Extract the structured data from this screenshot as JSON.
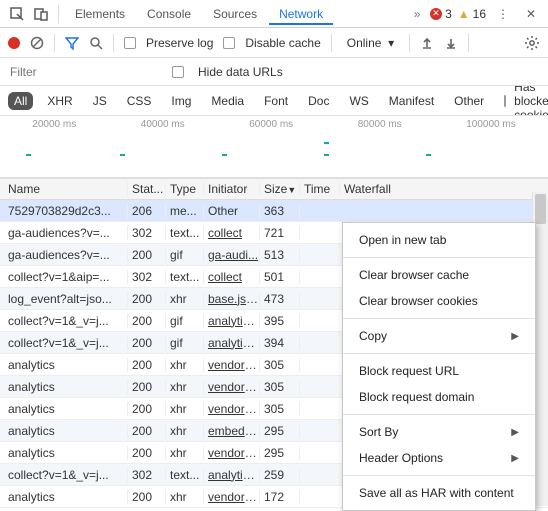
{
  "tabs": [
    "Elements",
    "Console",
    "Sources",
    "Network"
  ],
  "activeTab": "Network",
  "errors": "3",
  "warnings": "16",
  "toolbar": {
    "preserve": "Preserve log",
    "disable": "Disable cache",
    "throttle": "Online"
  },
  "filter": {
    "placeholder": "Filter",
    "hide": "Hide data URLs"
  },
  "chips": [
    "All",
    "XHR",
    "JS",
    "CSS",
    "Img",
    "Media",
    "Font",
    "Doc",
    "WS",
    "Manifest",
    "Other"
  ],
  "blocked": "Has blocked cookies",
  "timeline": [
    "20000 ms",
    "40000 ms",
    "60000 ms",
    "80000 ms",
    "100000 ms"
  ],
  "columns": {
    "name": "Name",
    "status": "Stat...",
    "type": "Type",
    "initiator": "Initiator",
    "size": "Size",
    "time": "Time",
    "waterfall": "Waterfall"
  },
  "rows": [
    {
      "name": "7529703829d2c3...",
      "status": "206",
      "type": "me...",
      "init": "Other",
      "size": "363",
      "time": ""
    },
    {
      "name": "ga-audiences?v=...",
      "status": "302",
      "type": "text...",
      "init": "collect",
      "size": "721",
      "time": ""
    },
    {
      "name": "ga-audiences?v=...",
      "status": "200",
      "type": "gif",
      "init": "ga-audi...",
      "size": "513",
      "time": ""
    },
    {
      "name": "collect?v=1&aip=...",
      "status": "302",
      "type": "text...",
      "init": "collect",
      "size": "501",
      "time": ""
    },
    {
      "name": "log_event?alt=jso...",
      "status": "200",
      "type": "xhr",
      "init": "base.js:1...",
      "size": "473",
      "time": ""
    },
    {
      "name": "collect?v=1&_v=j...",
      "status": "200",
      "type": "gif",
      "init": "analytics...",
      "size": "395",
      "time": ""
    },
    {
      "name": "collect?v=1&_v=j...",
      "status": "200",
      "type": "gif",
      "init": "analytics...",
      "size": "394",
      "time": ""
    },
    {
      "name": "analytics",
      "status": "200",
      "type": "xhr",
      "init": "vendor~...",
      "size": "305",
      "time": ""
    },
    {
      "name": "analytics",
      "status": "200",
      "type": "xhr",
      "init": "vendor~...",
      "size": "305",
      "time": ""
    },
    {
      "name": "analytics",
      "status": "200",
      "type": "xhr",
      "init": "vendor~...",
      "size": "305",
      "time": ""
    },
    {
      "name": "analytics",
      "status": "200",
      "type": "xhr",
      "init": "embed.7...",
      "size": "295",
      "time": ""
    },
    {
      "name": "analytics",
      "status": "200",
      "type": "xhr",
      "init": "vendor~...",
      "size": "295",
      "time": ""
    },
    {
      "name": "collect?v=1&_v=j...",
      "status": "302",
      "type": "text...",
      "init": "analytics...",
      "size": "259",
      "time": ""
    },
    {
      "name": "analytics",
      "status": "200",
      "type": "xhr",
      "init": "vendor~...",
      "size": "172",
      "time": ""
    }
  ],
  "selected": 0,
  "ctx": {
    "open": "Open in new tab",
    "clearCache": "Clear browser cache",
    "clearCookies": "Clear browser cookies",
    "copy": "Copy",
    "blockUrl": "Block request URL",
    "blockDomain": "Block request domain",
    "sort": "Sort By",
    "header": "Header Options",
    "saveHar": "Save all as HAR with content"
  }
}
